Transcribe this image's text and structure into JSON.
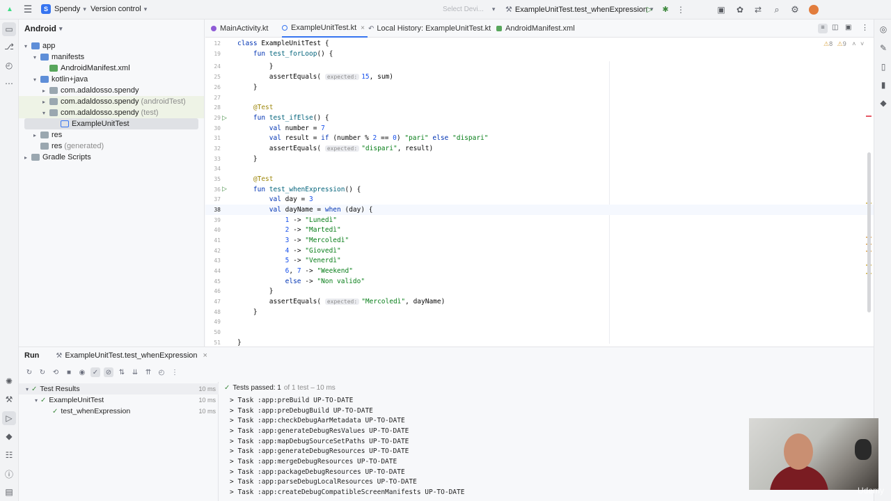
{
  "toolbar": {
    "project_initial": "S",
    "project_name": "Spendy",
    "vcs_label": "Version control",
    "device_placeholder": "Select Devi...",
    "run_config": "ExampleUnitTest.test_whenExpression"
  },
  "project_panel": {
    "view_label": "Android",
    "tree": [
      {
        "label": "app",
        "suffix": ""
      },
      {
        "label": "manifests",
        "suffix": ""
      },
      {
        "label": "AndroidManifest.xml",
        "suffix": ""
      },
      {
        "label": "kotlin+java",
        "suffix": ""
      },
      {
        "label": "com.adaldosso.spendy",
        "suffix": ""
      },
      {
        "label": "com.adaldosso.spendy",
        "suffix": "(androidTest)"
      },
      {
        "label": "com.adaldosso.spendy",
        "suffix": "(test)"
      },
      {
        "label": "ExampleUnitTest",
        "suffix": ""
      },
      {
        "label": "res",
        "suffix": ""
      },
      {
        "label": "res",
        "suffix": "(generated)"
      },
      {
        "label": "Gradle Scripts",
        "suffix": ""
      }
    ]
  },
  "editor_tabs": [
    {
      "label": "MainActivity.kt"
    },
    {
      "label": "ExampleUnitTest.kt"
    },
    {
      "label": "Local History: ExampleUnitTest.kt"
    },
    {
      "label": "AndroidManifest.xml"
    }
  ],
  "editor": {
    "inspections": {
      "warnings": "8",
      "weak": "9"
    },
    "line_numbers": [
      "12",
      "19",
      "24",
      "25",
      "26",
      "27",
      "28",
      "29",
      "30",
      "31",
      "32",
      "33",
      "34",
      "35",
      "36",
      "37",
      "38",
      "39",
      "40",
      "41",
      "42",
      "43",
      "44",
      "45",
      "46",
      "47",
      "48",
      "49",
      "50",
      "51"
    ],
    "hint_expected": "expected:"
  },
  "run_panel": {
    "tab_run": "Run",
    "tab_config": "ExampleUnitTest.test_whenExpression",
    "test_tree": [
      {
        "label": "Test Results",
        "time": "10 ms"
      },
      {
        "label": "ExampleUnitTest",
        "time": "10 ms"
      },
      {
        "label": "test_whenExpression",
        "time": "10 ms"
      }
    ],
    "status_passed": "Tests passed: 1",
    "status_detail": "of 1 test – 10 ms",
    "console_lines": [
      "> Task :app:preBuild UP-TO-DATE",
      "> Task :app:preDebugBuild UP-TO-DATE",
      "> Task :app:checkDebugAarMetadata UP-TO-DATE",
      "> Task :app:generateDebugResValues UP-TO-DATE",
      "> Task :app:mapDebugSourceSetPaths UP-TO-DATE",
      "> Task :app:generateDebugResources UP-TO-DATE",
      "> Task :app:mergeDebugResources UP-TO-DATE",
      "> Task :app:packageDebugResources UP-TO-DATE",
      "> Task :app:parseDebugLocalResources UP-TO-DATE",
      "> Task :app:createDebugCompatibleScreenManifests UP-TO-DATE"
    ]
  },
  "overlay": {
    "watermark": "Udemy"
  }
}
